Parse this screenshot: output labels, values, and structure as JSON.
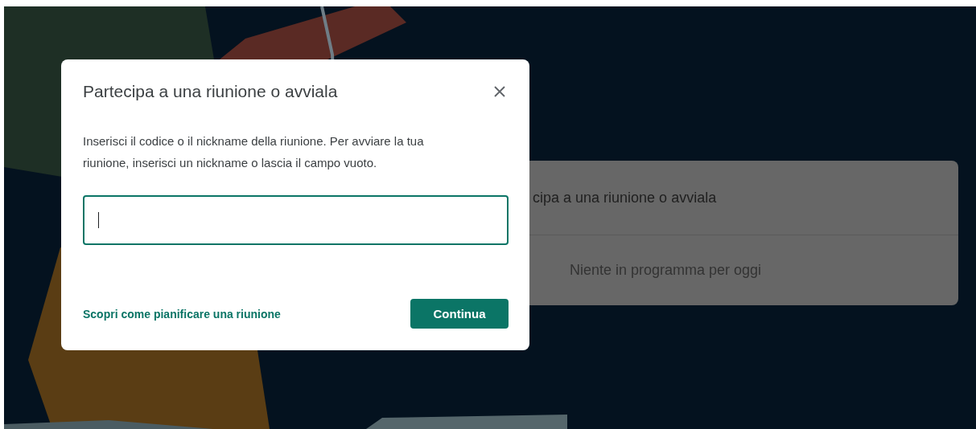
{
  "background_card": {
    "title": "cipa a una riunione o avviala",
    "empty_message": "Niente in programma per oggi"
  },
  "dialog": {
    "title": "Partecipa a una riunione o avviala",
    "description": "Inserisci il codice o il nickname della riunione. Per avviare la tua riunione, inserisci un nickname o lascia il campo vuoto.",
    "input": {
      "focused": true
    },
    "link": "Scopri come pianificare una riunione",
    "button": "Continua"
  }
}
